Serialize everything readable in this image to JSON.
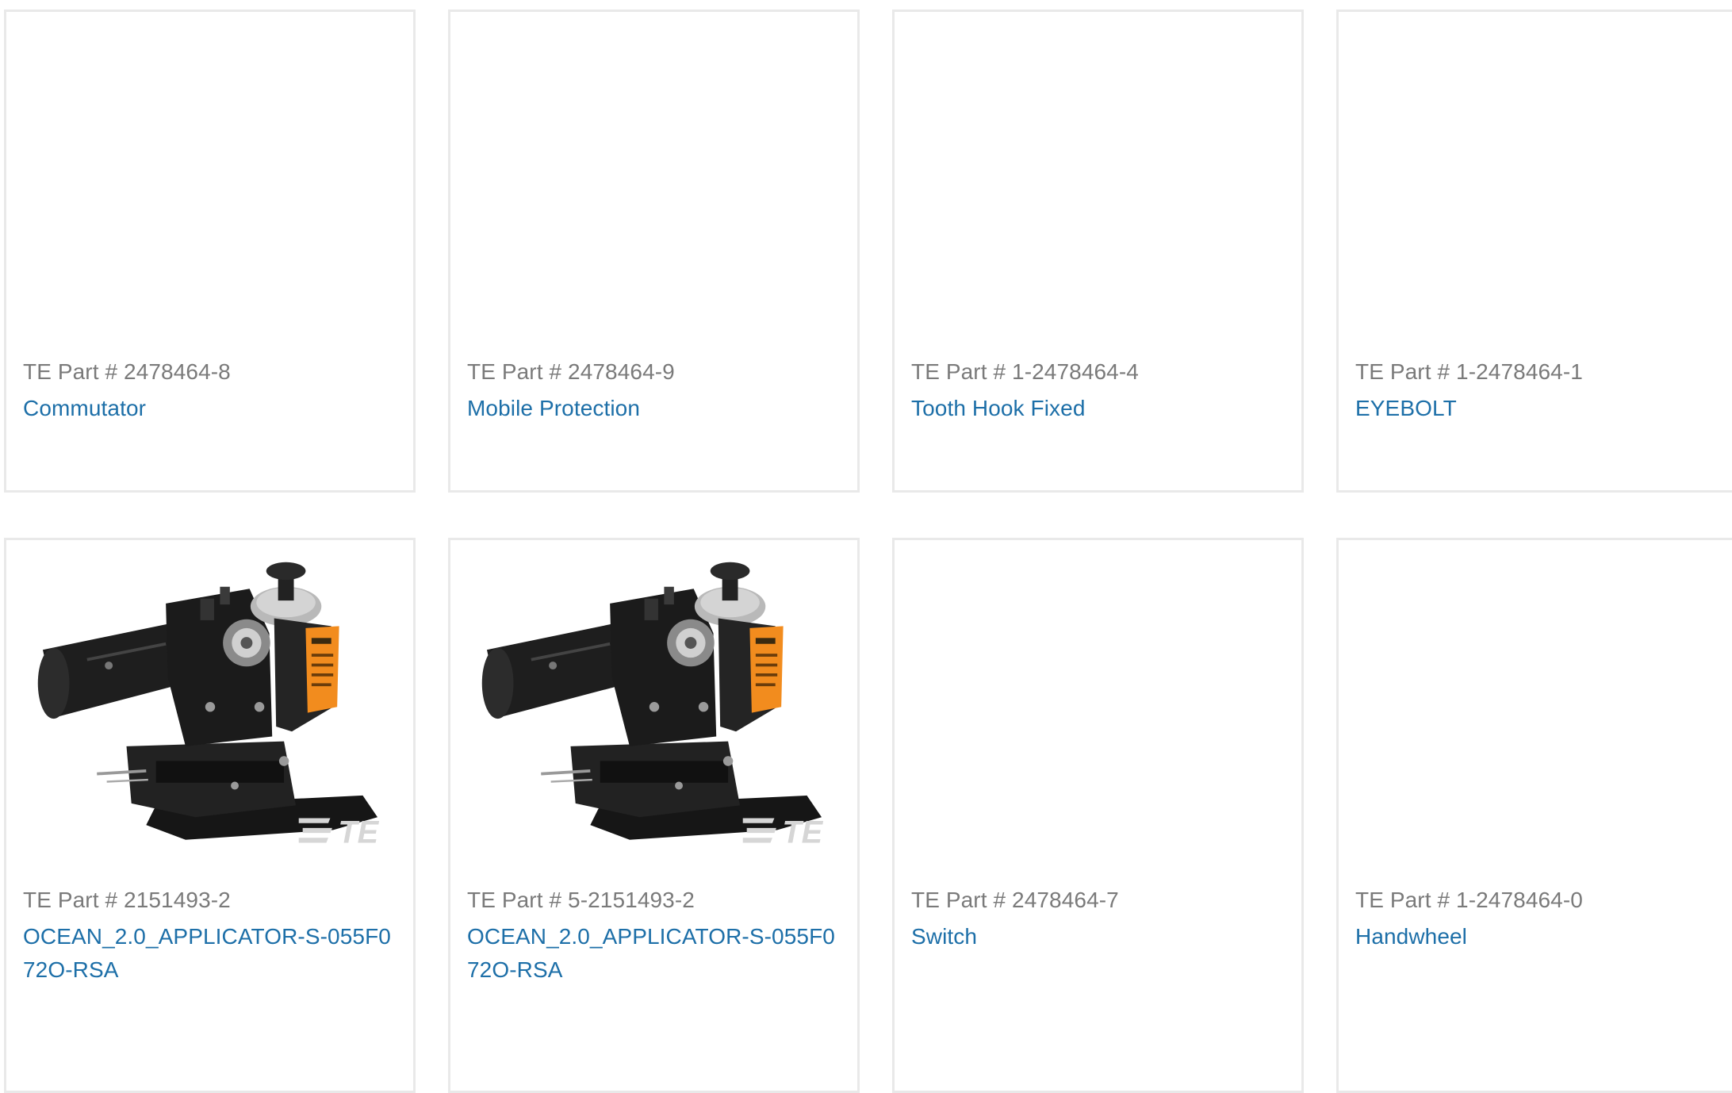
{
  "products": [
    {
      "part_label": "TE Part # 2478464-8",
      "name": "Commutator",
      "image": "none"
    },
    {
      "part_label": "TE Part # 2478464-9",
      "name": "Mobile Protection",
      "image": "none"
    },
    {
      "part_label": "TE Part # 1-2478464-4",
      "name": "Tooth Hook Fixed",
      "image": "none"
    },
    {
      "part_label": "TE Part # 1-2478464-1",
      "name": "EYEBOLT",
      "image": "none"
    },
    {
      "part_label": "TE Part # 2151493-2",
      "name": "OCEAN_2.0_APPLICATOR-S-055F072O-RSA",
      "image": "applicator-product-image"
    },
    {
      "part_label": "TE Part # 5-2151493-2",
      "name": "OCEAN_2.0_APPLICATOR-S-055F072O-RSA",
      "image": "applicator-product-image"
    },
    {
      "part_label": "TE Part # 2478464-7",
      "name": "Switch",
      "image": "none"
    },
    {
      "part_label": "TE Part # 1-2478464-0",
      "name": "Handwheel",
      "image": "none"
    }
  ],
  "watermark": "TE",
  "colors": {
    "link": "#1d6fa8",
    "part_label": "#7a7a7a",
    "card_border": "#e9e9e9",
    "applicator_body": "#1a1a1a",
    "applicator_label": "#f28c1e"
  }
}
